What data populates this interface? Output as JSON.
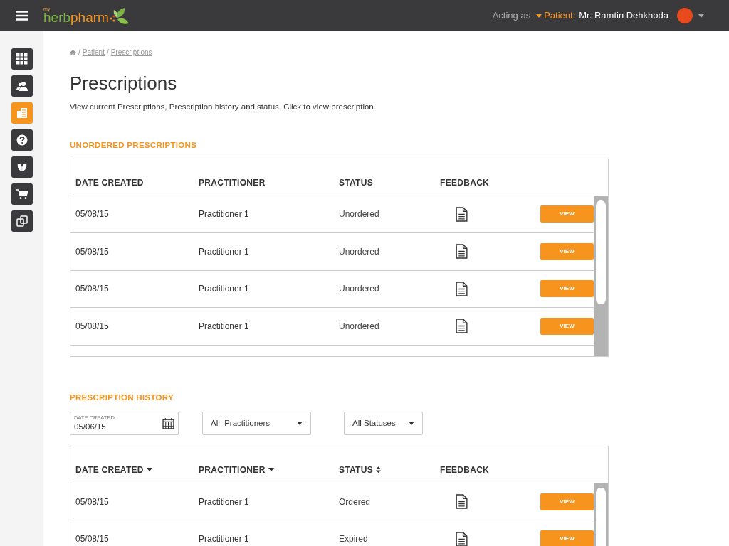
{
  "header": {
    "logo": {
      "small": "my",
      "first": "herb",
      "second": "pharm"
    },
    "acting_as": "Acting as",
    "role": "Patient:",
    "user": "Mr. Ramtin Dehkhoda"
  },
  "sidebar": {
    "items": [
      {
        "kind": "grid",
        "selected": false
      },
      {
        "kind": "users",
        "selected": false
      },
      {
        "kind": "list",
        "selected": true
      },
      {
        "kind": "help",
        "selected": false
      },
      {
        "kind": "leaf",
        "selected": false
      },
      {
        "kind": "cart",
        "selected": false
      },
      {
        "kind": "copy",
        "selected": false
      }
    ]
  },
  "breadcrumb": [
    {
      "separator": "/",
      "label": "Patient"
    },
    {
      "separator": "/",
      "label": "Prescriptions"
    }
  ],
  "title": "Prescriptions",
  "subtitle": "View current Prescriptions, Prescription history and status. Click to view prescription.",
  "unordered": {
    "heading": "UNORDERED PRESCRIPTIONS",
    "columns": [
      {
        "label": "DATE CREATED"
      },
      {
        "label": "PRACTITIONER"
      },
      {
        "label": "STATUS"
      },
      {
        "label": "FEEDBACK"
      }
    ],
    "rows": [
      {
        "date": "05/08/15",
        "practitioner": "Practitioner 1",
        "status": "Unordered",
        "action": "VIEW"
      },
      {
        "date": "05/08/15",
        "practitioner": "Practitioner 1",
        "status": "Unordered",
        "action": "VIEW"
      },
      {
        "date": "05/08/15",
        "practitioner": "Practitioner 1",
        "status": "Unordered",
        "action": "VIEW"
      },
      {
        "date": "05/08/15",
        "practitioner": "Practitioner 1",
        "status": "Unordered",
        "action": "VIEW"
      }
    ]
  },
  "history": {
    "heading": "PRESCRIPTION HISTORY",
    "date_filter": {
      "label": "DATE CREATED",
      "value": "05/06/15"
    },
    "practitioner_filter": "All  Practitioners",
    "status_filter": "All Statuses",
    "columns": [
      {
        "label": "DATE CREATED",
        "kind": "sort-down"
      },
      {
        "label": "PRACTITIONER",
        "kind": "sort-down"
      },
      {
        "label": "STATUS",
        "kind": "sort-both"
      },
      {
        "label": "FEEDBACK",
        "kind": "plain"
      }
    ],
    "rows": [
      {
        "date": "05/08/15",
        "practitioner": "Practitioner 1",
        "status": "Ordered",
        "action": "VIEW"
      },
      {
        "date": "05/08/15",
        "practitioner": "Practitioner 1",
        "status": "Expired",
        "action": "VIEW"
      }
    ]
  }
}
